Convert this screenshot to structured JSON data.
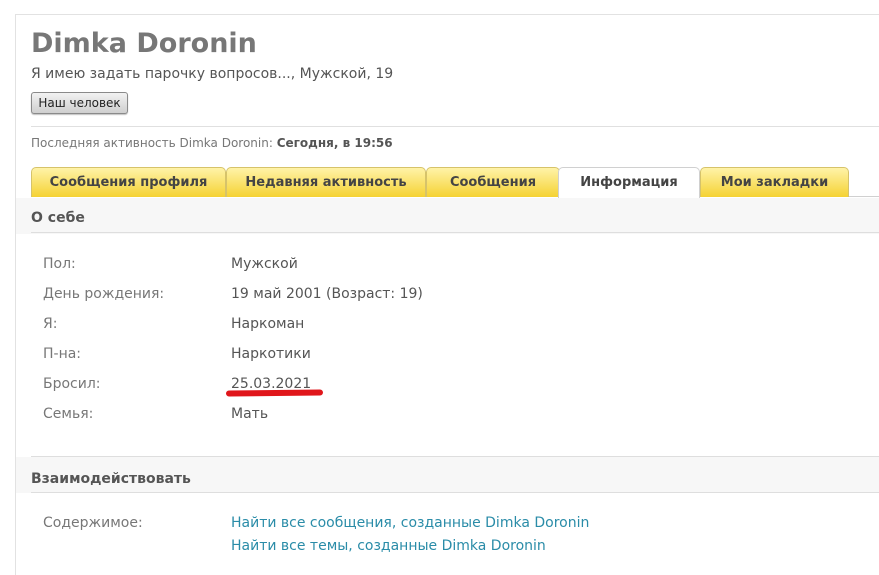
{
  "profile": {
    "username": "Dimka Doronin",
    "blurb": "Я имею задать парочку вопросов..., Мужской, 19",
    "user_title_button": "Наш человек",
    "last_activity_label": "Последняя активность Dimka Doronin:",
    "last_activity_value": "Сегодня, в 19:56"
  },
  "tabs": [
    {
      "label": "Сообщения профиля",
      "active": false
    },
    {
      "label": "Недавняя активность",
      "active": false
    },
    {
      "label": "Сообщения",
      "active": false
    },
    {
      "label": "Информация",
      "active": true
    },
    {
      "label": "Мои закладки",
      "active": false
    }
  ],
  "about": {
    "title": "О себе",
    "rows": [
      {
        "label": "Пол:",
        "value": "Мужской"
      },
      {
        "label": "День рождения:",
        "value": "19 май 2001 (Возраст: 19)"
      },
      {
        "label": "Я:",
        "value": "Наркоман"
      },
      {
        "label": "П-на:",
        "value": "Наркотики"
      },
      {
        "label": "Бросил:",
        "value": "25.03.2021"
      },
      {
        "label": "Семья:",
        "value": "Мать"
      }
    ]
  },
  "interact": {
    "title": "Взаимодействовать",
    "content_label": "Содержимое:",
    "links": [
      "Найти все сообщения, созданные Dimka Doronin",
      "Найти все темы, созданные Dimka Doronin"
    ]
  },
  "colors": {
    "tab_gradient_top": "#fff3a8",
    "tab_gradient_bottom": "#f5d233",
    "link": "#2a8ca8",
    "annotation_underline": "#e0161b"
  }
}
